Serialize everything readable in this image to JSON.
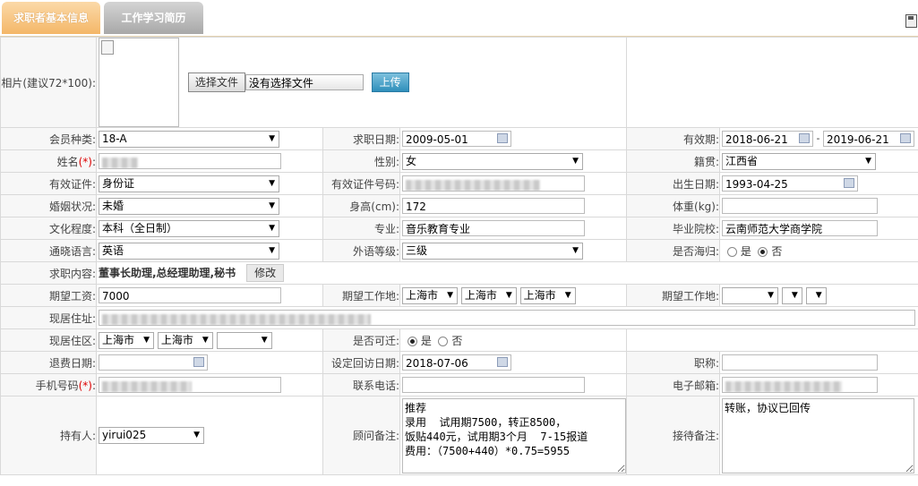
{
  "tabs": [
    "求职者基本信息",
    "工作学习简历"
  ],
  "photo": {
    "label": "相片(建议72*100):",
    "file_button": "选择文件",
    "file_status": "没有选择文件",
    "upload_button": "上传"
  },
  "member_type": {
    "label": "会员种类:",
    "value": "18-A"
  },
  "job_date": {
    "label": "求职日期:",
    "value": "2009-05-01"
  },
  "valid_period": {
    "label": "有效期:",
    "from": "2018-06-21",
    "sep": "-",
    "to": "2019-06-21"
  },
  "name": {
    "label": "姓名",
    "req": "(*)",
    "colon": ":"
  },
  "gender": {
    "label": "性别:",
    "value": "女"
  },
  "native": {
    "label": "籍贯:",
    "value": "江西省"
  },
  "id_type": {
    "label": "有效证件:",
    "value": "身份证"
  },
  "id_number": {
    "label": "有效证件号码:"
  },
  "birth": {
    "label": "出生日期:",
    "value": "1993-04-25"
  },
  "marital": {
    "label": "婚姻状况:",
    "value": "未婚"
  },
  "height": {
    "label": "身高(cm):",
    "value": "172"
  },
  "weight": {
    "label": "体重(kg):",
    "value": ""
  },
  "education": {
    "label": "文化程度:",
    "value": "本科（全日制）"
  },
  "major": {
    "label": "专业:",
    "value": "音乐教育专业"
  },
  "school": {
    "label": "毕业院校:",
    "value": "云南师范大学商学院"
  },
  "language": {
    "label": "通晓语言:",
    "value": "英语"
  },
  "lang_level": {
    "label": "外语等级:",
    "value": "三级"
  },
  "overseas": {
    "label": "是否海归:",
    "yes": "是",
    "no": "否"
  },
  "job_content": {
    "label": "求职内容:",
    "value": "董事长助理,总经理助理,秘书",
    "edit_button": "修改"
  },
  "salary": {
    "label": "期望工资:",
    "value": "7000"
  },
  "work_place1": {
    "label": "期望工作地:",
    "v1": "上海市",
    "v2": "上海市",
    "v3": "上海市"
  },
  "work_place2": {
    "label": "期望工作地:"
  },
  "address": {
    "label": "现居住址:"
  },
  "district": {
    "label": "现居住区:",
    "v1": "上海市",
    "v2": "上海市"
  },
  "relocate": {
    "label": "是否可迁:",
    "yes": "是",
    "no": "否"
  },
  "refund_date": {
    "label": "退费日期:"
  },
  "visit_date": {
    "label": "设定回访日期:",
    "value": "2018-07-06"
  },
  "title": {
    "label": "职称:"
  },
  "mobile": {
    "label": "手机号码",
    "req": "(*)",
    "colon": ":"
  },
  "phone": {
    "label": "联系电话:"
  },
  "email": {
    "label": "电子邮箱:"
  },
  "holder": {
    "label": "持有人:",
    "value": "yirui025"
  },
  "consultant_note": {
    "label": "顾问备注:",
    "value": "推荐\n录用  试用期7500，转正8500，\n饭贴440元，试用期3个月  7-15报道\n费用：（7500+440）*0.75=5955"
  },
  "reception_note": {
    "label": "接待备注:",
    "value": "转账，协议已回传"
  }
}
